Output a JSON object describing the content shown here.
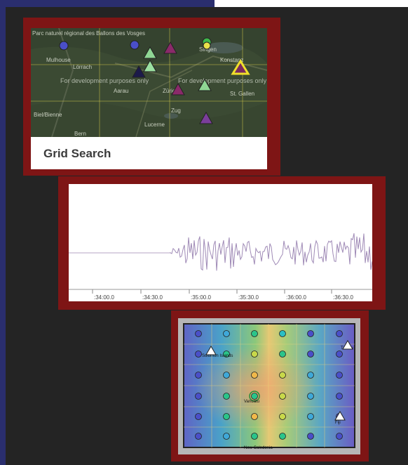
{
  "card1": {
    "title": "Grid Search",
    "watermark": "For development purposes only",
    "map_labels": [
      "Parc naturel régional des Ballons des Vosges",
      "Mulhouse",
      "Lörrach",
      "Aarau",
      "Zürich",
      "Singen",
      "Konstanz",
      "St. Gallen",
      "Biel/Bienne",
      "Lucerne",
      "Zug",
      "Bern"
    ]
  },
  "card2": {
    "ticks": [
      ":34:00.0",
      ":34:30.0",
      ":35:00.0",
      ":35:30.0",
      ":36:00.0",
      ":36:30.0"
    ]
  },
  "card3": {
    "places": [
      "Solomon Islands",
      "Vanuatu",
      "New Caledonia",
      "Tuvalu",
      "Fiji"
    ]
  }
}
